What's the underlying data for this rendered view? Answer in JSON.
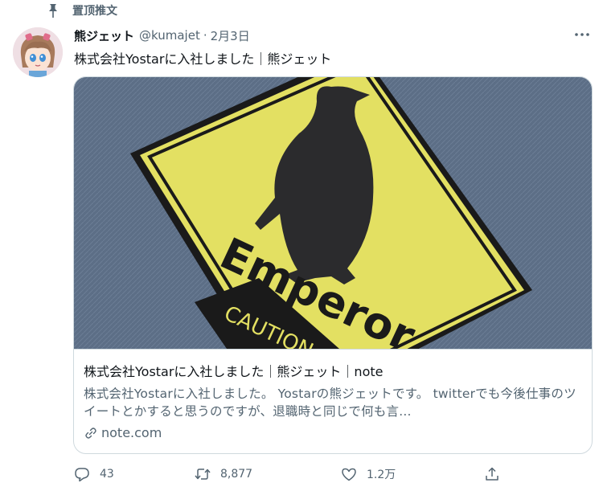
{
  "pinned": {
    "label": "置顶推文",
    "icon": "pin-icon"
  },
  "tweet": {
    "author_name": "熊ジェット",
    "handle": "@kumajet",
    "separator": "·",
    "date": "2月3日",
    "text": "株式会社Yostarに入社しました｜熊ジェット",
    "more_icon": "more-icon"
  },
  "card": {
    "sign_text_main": "Emperor",
    "sign_text_caution": "CAUTION",
    "title": "株式会社Yostarに入社しました｜熊ジェット｜note",
    "description": "株式会社Yostarに入社しました。 Yostarの熊ジェットです。 twitterでも今後仕事のツイートとかすると思うのですが、退職時と同じで何も言...",
    "domain": "note.com",
    "colors": {
      "sign_yellow": "#e3e062",
      "background_denim": "#5c6e86",
      "silhouette": "#2b2b2d"
    }
  },
  "actions": {
    "reply_count": "43",
    "retweet_count": "8,877",
    "like_count": "1.2万"
  },
  "colors": {
    "text_primary": "#0f1419",
    "text_secondary": "#536471",
    "border": "#cfd9de"
  }
}
